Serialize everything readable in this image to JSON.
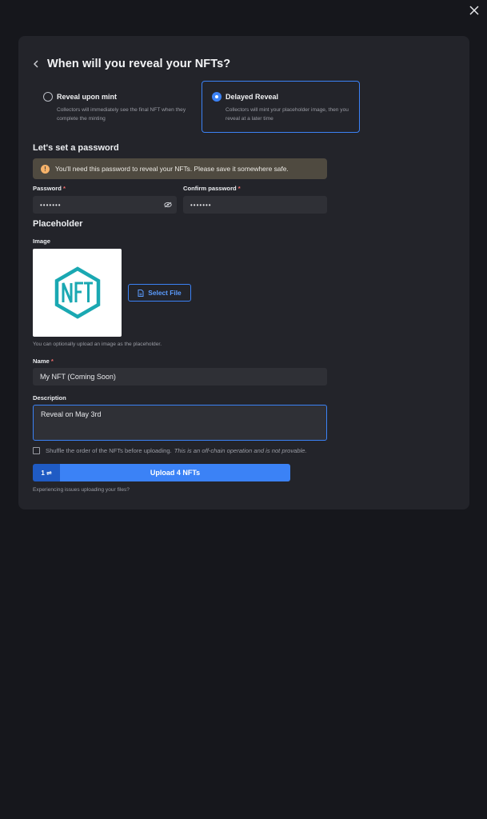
{
  "dialog": {
    "title": "When will you reveal your NFTs?",
    "options": [
      {
        "title": "Reveal upon mint",
        "description": "Collectors will immediately see the final NFT when they complete the minting",
        "selected": false
      },
      {
        "title": "Delayed Reveal",
        "description": "Collectors will mint your placeholder image, then you reveal at a later time",
        "selected": true
      }
    ]
  },
  "password_section": {
    "title": "Let's set a password",
    "warning": "You'll need this password to reveal your NFTs. Please save it somewhere safe.",
    "password_label": "Password",
    "password_value": "•••••••",
    "confirm_label": "Confirm password",
    "confirm_value": "•••••••",
    "required_mark": "*"
  },
  "placeholder": {
    "title": "Placeholder",
    "image_label": "Image",
    "image_text": "NFT",
    "select_file_label": "Select File",
    "image_hint": "You can optionally upload an image as the placeholder.",
    "name_label": "Name",
    "name_value": "My NFT (Coming Soon)",
    "description_label": "Description",
    "description_value": "Reveal on May 3rd"
  },
  "shuffle": {
    "label": "Shuffle the order of the NFTs before uploading.",
    "note": "This is an off-chain operation and is not provable.",
    "checked": false
  },
  "upload": {
    "quantity": "1 ⇌",
    "button_label": "Upload 4 NFTs",
    "help_text": "Experiencing issues uploading your files?"
  },
  "colors": {
    "accent": "#3b82f6",
    "background": "#16171c",
    "panel": "#23242a",
    "warning_bg": "#4f4a40",
    "nft_teal": "#1aa8b2"
  },
  "icons": [
    "close-icon",
    "chevron-left-icon",
    "eye-off-icon",
    "file-icon",
    "warning-icon"
  ]
}
